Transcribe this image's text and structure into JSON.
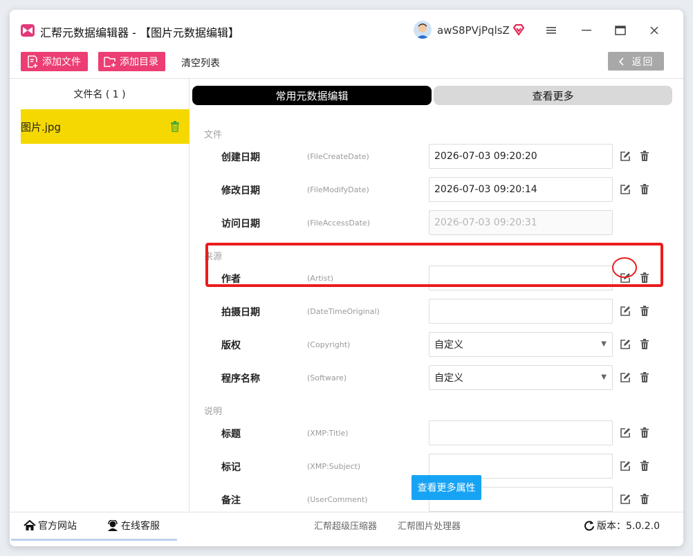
{
  "window": {
    "title": "汇帮元数据编辑器 - 【图片元数据编辑】",
    "username": "awS8PVjPqlsZ"
  },
  "toolbar": {
    "add_file_label": "添加文件",
    "add_dir_label": "添加目录",
    "clear_label": "清空列表",
    "back_label": "返回"
  },
  "sidebar": {
    "file_count_label": "文件名 ( 1 )",
    "files": [
      {
        "name": "图片.jpg"
      }
    ]
  },
  "tabs": {
    "common_label": "常用元数据编辑",
    "more_label": "查看更多"
  },
  "sections": {
    "file": "文件",
    "source": "来源",
    "desc": "说明"
  },
  "fields": [
    {
      "label": "创建日期",
      "key": "(FileCreateDate)",
      "value": "2026-07-03 09:20:20"
    },
    {
      "label": "修改日期",
      "key": "(FileModifyDate)",
      "value": "2026-07-03 09:20:14"
    },
    {
      "label": "访问日期",
      "key": "(FileAccessDate)",
      "value": "2026-07-03 09:20:31"
    },
    {
      "label": "作者",
      "key": "(Artist)",
      "value": ""
    },
    {
      "label": "拍摄日期",
      "key": "(DateTimeOriginal)",
      "value": ""
    },
    {
      "label": "版权",
      "key": "(Copyright)",
      "value": "自定义"
    },
    {
      "label": "程序名称",
      "key": "(Software)",
      "value": "自定义"
    },
    {
      "label": "标题",
      "key": "(XMP:Title)",
      "value": ""
    },
    {
      "label": "标记",
      "key": "(XMP:Subject)",
      "value": ""
    },
    {
      "label": "备注",
      "key": "(UserComment)",
      "value": ""
    }
  ],
  "more_attrs_label": "查看更多属性",
  "footer": {
    "website": "官方网站",
    "support": "在线客服",
    "compressor": "汇帮超级压缩器",
    "image_tool": "汇帮图片处理器",
    "version": "版本：5.0.2.0"
  },
  "colors": {
    "accent": "#ec3e72",
    "selected_file": "#f5d800",
    "highlight": "#ea1c1c",
    "info_button": "#17a3f4"
  }
}
